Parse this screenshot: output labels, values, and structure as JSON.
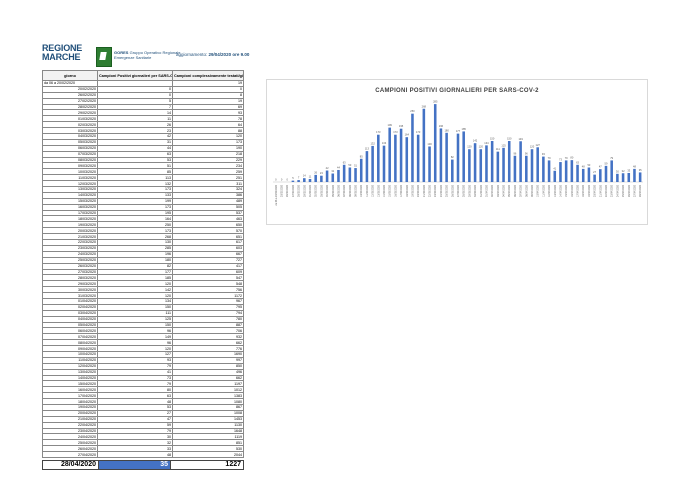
{
  "header": {
    "logo_line1": "REGIONE",
    "logo_line2": "MARCHE",
    "org_name": "GORES",
    "org_line1": "Gruppo Operativo Regionale",
    "org_line2": "Emergenze Sanitarie",
    "update_prefix": "aggiornamento:",
    "update_value": "29/04/2020 ore 9.00"
  },
  "table": {
    "columns": [
      "giorno",
      "Campioni Positivi giornalieri per SARS-Cov-2",
      "Campioni complessivamente testati/giorno"
    ],
    "first_row": {
      "giorno": "da 06 a 20/02/2020",
      "positivi": "",
      "testati": "19"
    },
    "rows": [
      [
        "20/02/2020",
        "0",
        "0"
      ],
      [
        "26/02/2020",
        "0",
        "8"
      ],
      [
        "27/02/2020",
        "5",
        "19"
      ],
      [
        "28/02/2020",
        "7",
        "69"
      ],
      [
        "29/02/2020",
        "14",
        "93"
      ],
      [
        "01/03/2020",
        "11",
        "78"
      ],
      [
        "02/03/2020",
        "26",
        "64"
      ],
      [
        "03/03/2020",
        "23",
        "88"
      ],
      [
        "04/03/2020",
        "42",
        "120"
      ],
      [
        "05/03/2020",
        "31",
        "173"
      ],
      [
        "06/03/2020",
        "44",
        "190"
      ],
      [
        "07/03/2020",
        "63",
        "218"
      ],
      [
        "08/03/2020",
        "53",
        "229"
      ],
      [
        "09/03/2020",
        "51",
        "234"
      ],
      [
        "10/03/2020",
        "85",
        "259"
      ],
      [
        "11/03/2020",
        "113",
        "251"
      ],
      [
        "12/03/2020",
        "132",
        "311"
      ],
      [
        "13/03/2020",
        "173",
        "324"
      ],
      [
        "14/03/2020",
        "133",
        "386"
      ],
      [
        "15/03/2020",
        "199",
        "489"
      ],
      [
        "16/03/2020",
        "173",
        "505"
      ],
      [
        "17/03/2020",
        "195",
        "537"
      ],
      [
        "18/03/2020",
        "164",
        "463"
      ],
      [
        "19/03/2020",
        "250",
        "650"
      ],
      [
        "20/03/2020",
        "173",
        "570"
      ],
      [
        "21/03/2020",
        "268",
        "651"
      ],
      [
        "22/03/2020",
        "130",
        "617"
      ],
      [
        "23/03/2020",
        "285",
        "603"
      ],
      [
        "24/03/2020",
        "196",
        "667"
      ],
      [
        "25/03/2020",
        "180",
        "727"
      ],
      [
        "26/03/2020",
        "82",
        "417"
      ],
      [
        "27/03/2020",
        "177",
        "609"
      ],
      [
        "28/03/2020",
        "185",
        "547"
      ],
      [
        "29/03/2020",
        "120",
        "548"
      ],
      [
        "30/03/2020",
        "142",
        "756"
      ],
      [
        "31/03/2020",
        "120",
        "1172"
      ],
      [
        "01/04/2020",
        "134",
        "967"
      ],
      [
        "02/04/2020",
        "150",
        "795"
      ],
      [
        "03/04/2020",
        "111",
        "794"
      ],
      [
        "04/04/2020",
        "125",
        "780"
      ],
      [
        "05/04/2020",
        "150",
        "887"
      ],
      [
        "06/04/2020",
        "96",
        "706"
      ],
      [
        "07/04/2020",
        "149",
        "932"
      ],
      [
        "08/04/2020",
        "96",
        "662"
      ],
      [
        "09/04/2020",
        "120",
        "776"
      ],
      [
        "10/04/2020",
        "127",
        "1690"
      ],
      [
        "11/04/2020",
        "93",
        "997"
      ],
      [
        "12/04/2020",
        "79",
        "850"
      ],
      [
        "13/04/2020",
        "41",
        "496"
      ],
      [
        "14/04/2020",
        "73",
        "662"
      ],
      [
        "15/04/2020",
        "79",
        "1197"
      ],
      [
        "16/04/2020",
        "80",
        "1012"
      ],
      [
        "17/04/2020",
        "63",
        "1383"
      ],
      [
        "18/04/2020",
        "48",
        "1080"
      ],
      [
        "19/04/2020",
        "53",
        "867"
      ],
      [
        "20/04/2020",
        "27",
        "1008"
      ],
      [
        "21/04/2020",
        "47",
        "1453"
      ],
      [
        "22/04/2020",
        "59",
        "1130"
      ],
      [
        "23/04/2020",
        "79",
        "1648"
      ],
      [
        "24/04/2020",
        "30",
        "1119"
      ],
      [
        "25/04/2020",
        "32",
        "851"
      ],
      [
        "26/04/2020",
        "33",
        "530"
      ],
      [
        "27/04/2020",
        "48",
        "2044"
      ]
    ],
    "totals": {
      "date": "28/04/2020",
      "positivi": "35",
      "testati": "1227"
    }
  },
  "chart_data": {
    "type": "bar",
    "title": "CAMPIONI POSITIVI GIORNALIERI PER SARS-COV-2",
    "categories": [
      "da 06 a 20/02/2020",
      "20/02/2020",
      "26/02/2020",
      "27/02/2020",
      "28/02/2020",
      "29/02/2020",
      "01/03/2020",
      "02/03/2020",
      "03/03/2020",
      "04/03/2020",
      "05/03/2020",
      "06/03/2020",
      "07/03/2020",
      "08/03/2020",
      "09/03/2020",
      "10/03/2020",
      "11/03/2020",
      "12/03/2020",
      "13/03/2020",
      "14/03/2020",
      "15/03/2020",
      "16/03/2020",
      "17/03/2020",
      "18/03/2020",
      "19/03/2020",
      "20/03/2020",
      "21/03/2020",
      "22/03/2020",
      "23/03/2020",
      "24/03/2020",
      "25/03/2020",
      "26/03/2020",
      "27/03/2020",
      "28/03/2020",
      "29/03/2020",
      "30/03/2020",
      "31/03/2020",
      "01/04/2020",
      "02/04/2020",
      "03/04/2020",
      "04/04/2020",
      "05/04/2020",
      "06/04/2020",
      "07/04/2020",
      "08/04/2020",
      "09/04/2020",
      "10/04/2020",
      "11/04/2020",
      "12/04/2020",
      "13/04/2020",
      "14/04/2020",
      "15/04/2020",
      "16/04/2020",
      "17/04/2020",
      "18/04/2020",
      "19/04/2020",
      "20/04/2020",
      "21/04/2020",
      "22/04/2020",
      "23/04/2020",
      "24/04/2020",
      "25/04/2020",
      "26/04/2020",
      "27/04/2020",
      "28/04/2020"
    ],
    "values": [
      0,
      0,
      0,
      5,
      7,
      14,
      11,
      26,
      23,
      42,
      31,
      44,
      63,
      53,
      51,
      85,
      113,
      132,
      173,
      133,
      199,
      173,
      195,
      164,
      250,
      173,
      268,
      130,
      285,
      196,
      180,
      82,
      177,
      185,
      120,
      142,
      120,
      134,
      150,
      111,
      125,
      150,
      96,
      149,
      96,
      120,
      127,
      93,
      79,
      41,
      73,
      79,
      80,
      63,
      48,
      53,
      27,
      47,
      59,
      79,
      30,
      32,
      33,
      48,
      35
    ],
    "bar_color": "#4472c4",
    "ylim": [
      0,
      300
    ]
  }
}
